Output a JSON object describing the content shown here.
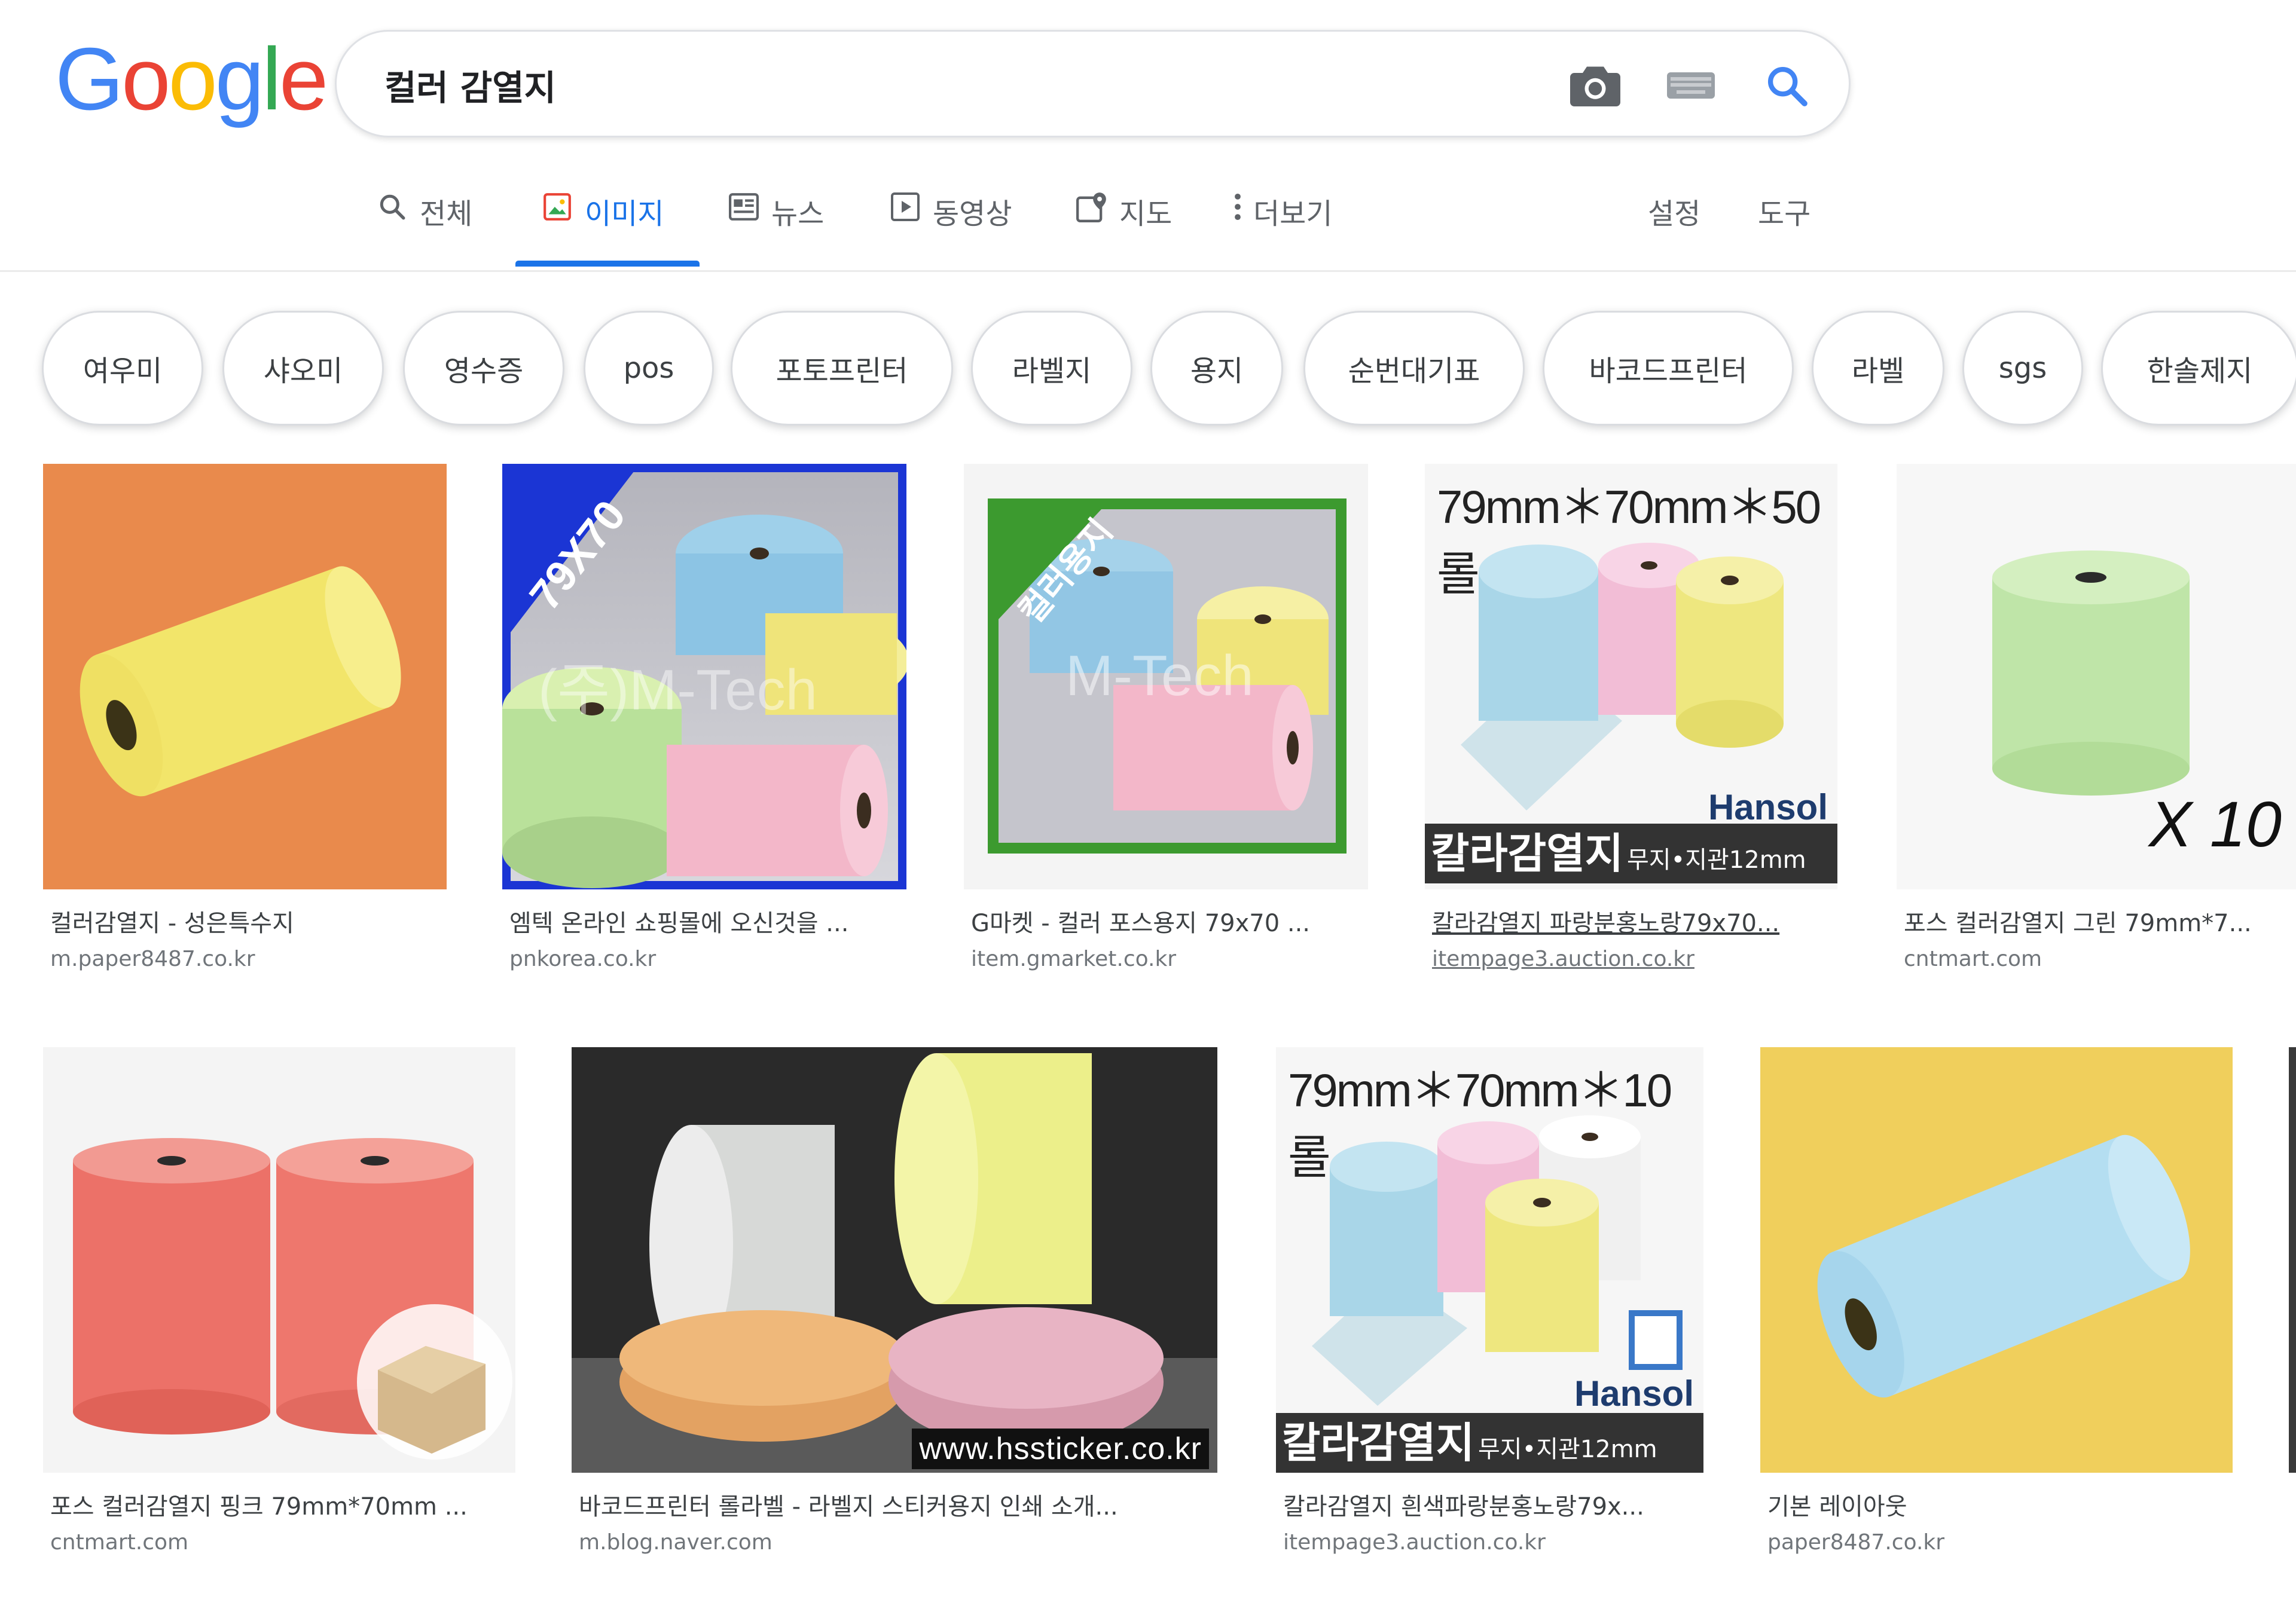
{
  "logo": {
    "letters": [
      "G",
      "o",
      "o",
      "g",
      "l",
      "e"
    ],
    "colors": [
      "#4285f4",
      "#ea4335",
      "#fbbc05",
      "#4285f4",
      "#34a853",
      "#ea4335"
    ]
  },
  "search": {
    "query": "컬러 감열지"
  },
  "tabs": [
    {
      "label": "전체",
      "icon": "search-icon",
      "active": false
    },
    {
      "label": "이미지",
      "icon": "image-icon",
      "active": true
    },
    {
      "label": "뉴스",
      "icon": "news-icon",
      "active": false
    },
    {
      "label": "동영상",
      "icon": "video-icon",
      "active": false
    },
    {
      "label": "지도",
      "icon": "map-icon",
      "active": false
    },
    {
      "label": "더보기",
      "icon": "more-vert-icon",
      "active": false
    }
  ],
  "tools": {
    "settings": "설정",
    "tools": "도구"
  },
  "chips": [
    "여우미",
    "샤오미",
    "영수증",
    "pos",
    "포토프린터",
    "라벨지",
    "용지",
    "순번대기표",
    "바코드프린터",
    "라벨",
    "sgs",
    "한솔제지"
  ],
  "results": [
    {
      "caption": "컬러감열지 - 성은특수지",
      "source": "m.paper8487.co.kr"
    },
    {
      "caption": "엠텍 온라인 쇼핑몰에 오신것을 ...",
      "source": "pnkorea.co.kr",
      "overlay": "79X70",
      "watermark": "(주)M-Tech"
    },
    {
      "caption": "G마켓 - 컬러 포스용지 79x70 ...",
      "source": "item.gmarket.co.kr",
      "overlay": "컬러용지",
      "watermark": "M-Tech"
    },
    {
      "caption": "칼라감열지 파랑분홍노랑79x70...",
      "source": "itempage3.auction.co.kr",
      "header": "79mm＊70mm＊50롤",
      "brand": "Hansol",
      "banner": "칼라감열지",
      "banner_small": "무지•지관12mm"
    },
    {
      "caption": "포스 컬러감열지 그린 79mm*7...",
      "source": "cntmart.com",
      "overlay": "X 10"
    },
    {
      "caption": "포스 컬러감열지 핑크 79mm*70mm ...",
      "source": "cntmart.com"
    },
    {
      "caption": "바코드프린터 롤라벨 - 라벨지 스티커용지 인쇄 소개...",
      "source": "m.blog.naver.com",
      "banner": "www.hssticker.co.kr"
    },
    {
      "caption": "칼라감열지 흰색파랑분홍노랑79x...",
      "source": "itempage3.auction.co.kr",
      "header": "79mm＊70mm＊10롤",
      "brand": "Hansol",
      "banner": "칼라감열지",
      "banner_small": "무지•지관12mm"
    },
    {
      "caption": "기본 레이아웃",
      "source": "paper8487.co.kr"
    }
  ]
}
